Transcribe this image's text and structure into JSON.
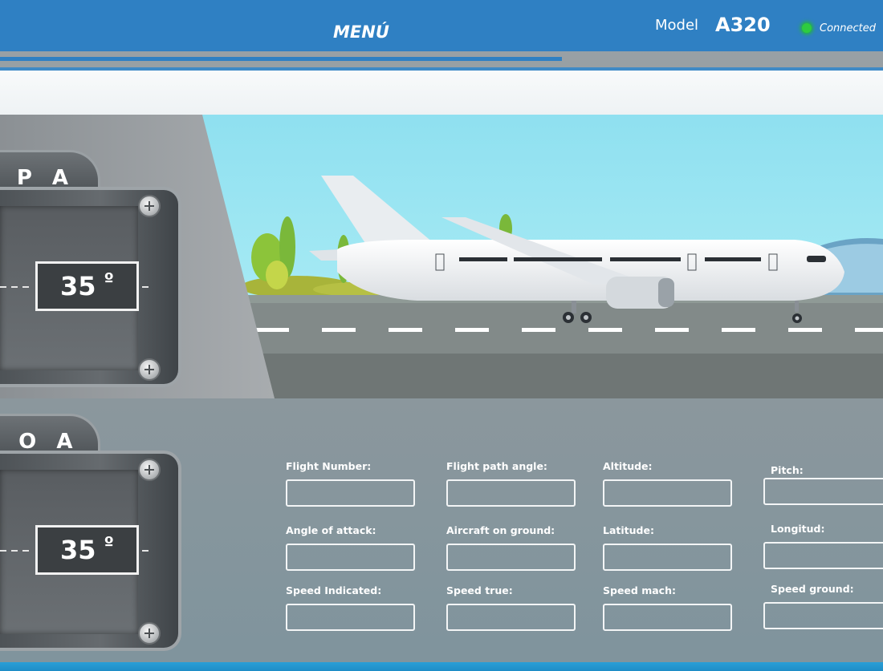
{
  "header": {
    "menu_label": "MENÚ",
    "model_label": "Model",
    "model_value": "A320",
    "status_text": "Connected",
    "accent_color": "#2f80c3",
    "status_color": "#2ecc40"
  },
  "gauges": [
    {
      "label": "F P A",
      "value": "35",
      "unit": "º"
    },
    {
      "label": "A O A",
      "value": "35",
      "unit": "º"
    }
  ],
  "fields": [
    {
      "label": "Flight Number:",
      "value": ""
    },
    {
      "label": "Flight path angle:",
      "value": ""
    },
    {
      "label": "Altitude:",
      "value": ""
    },
    {
      "label": "Pitch:",
      "value": ""
    },
    {
      "label": "Angle of attack:",
      "value": ""
    },
    {
      "label": "Aircraft on ground:",
      "value": ""
    },
    {
      "label": "Latitude:",
      "value": ""
    },
    {
      "label": "Longitud:",
      "value": ""
    },
    {
      "label": "Speed Indicated:",
      "value": ""
    },
    {
      "label": "Speed true:",
      "value": ""
    },
    {
      "label": "Speed mach:",
      "value": ""
    },
    {
      "label": "Speed ground:",
      "value": ""
    }
  ]
}
